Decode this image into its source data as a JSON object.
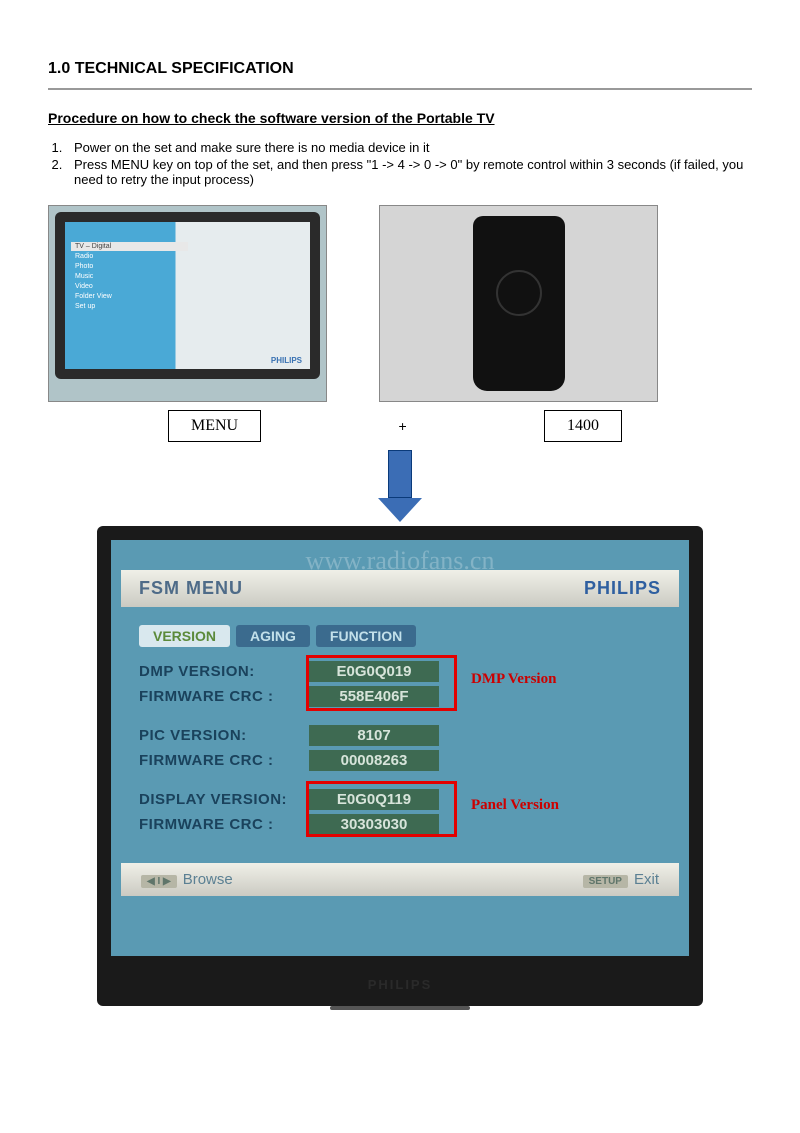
{
  "section_title": "1.0 TECHNICAL SPECIFICATION",
  "subtitle": "Procedure on how to check the software version of the Portable TV",
  "steps": [
    "Power on the set and make sure there is no media device in it",
    "Press MENU key on top of the set, and then press \"1 -> 4 -> 0 -> 0\" by remote control within 3 seconds (if failed, you need to retry the input process)"
  ],
  "tv_small_menu": [
    "TV – Digital",
    "Radio",
    "Photo",
    "Music",
    "Video",
    "Folder View",
    "Set up"
  ],
  "tv_small_brand": "PHILIPS",
  "box_menu": "MENU",
  "plus": "+",
  "box_code": "1400",
  "watermark": "www.radiofans.cn",
  "fsm": {
    "title": "FSM MENU",
    "brand": "PHILIPS",
    "tabs": [
      "VERSION",
      "AGING",
      "FUNCTION"
    ],
    "rows": [
      {
        "label": "DMP VERSION:",
        "value": "E0G0Q019"
      },
      {
        "label": "FIRMWARE CRC :",
        "value": "558E406F"
      },
      {
        "label": "PIC VERSION:",
        "value": "8107"
      },
      {
        "label": "FIRMWARE CRC :",
        "value": "00008263"
      },
      {
        "label": "DISPLAY VERSION:",
        "value": "E0G0Q119"
      },
      {
        "label": "FIRMWARE CRC :",
        "value": "30303030"
      }
    ],
    "annot_dmp": "DMP Version",
    "annot_panel": "Panel Version",
    "nav_left_btn": "◀ I ▶",
    "nav_left": "Browse",
    "nav_right_btn": "SETUP",
    "nav_right": "Exit",
    "bottom_brand": "PHILIPS"
  }
}
